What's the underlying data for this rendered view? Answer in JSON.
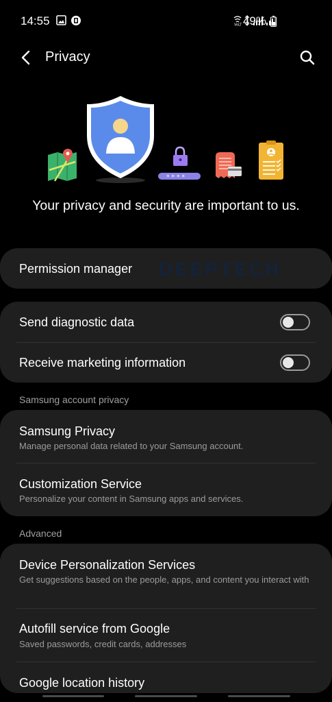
{
  "status_bar": {
    "time": "14:55",
    "battery": "49%",
    "icons": [
      "gallery-icon",
      "app-notification-icon",
      "wifi-calling-icon",
      "signal-icon",
      "signal-icon",
      "battery-icon"
    ]
  },
  "header": {
    "title": "Privacy",
    "back_icon": "back-arrow-icon",
    "search_icon": "search-icon"
  },
  "tagline": "Your privacy and security are important to us.",
  "watermark": "DEEPTECH",
  "permission_manager": {
    "title": "Permission manager"
  },
  "toggles": [
    {
      "title": "Send diagnostic data",
      "on": false
    },
    {
      "title": "Receive marketing information",
      "on": false
    }
  ],
  "samsung_section": {
    "header": "Samsung account privacy",
    "items": [
      {
        "title": "Samsung Privacy",
        "subtitle": "Manage personal data related to your Samsung account."
      },
      {
        "title": "Customization Service",
        "subtitle": "Personalize your content in Samsung apps and services."
      }
    ]
  },
  "advanced_section": {
    "header": "Advanced",
    "items": [
      {
        "title": "Device Personalization Services",
        "subtitle": "Get suggestions based on the people, apps, and content you interact with"
      },
      {
        "title": "Autofill service from Google",
        "subtitle": "Saved passwords, credit cards, addresses"
      },
      {
        "title": "Google location history",
        "subtitle": ""
      }
    ]
  },
  "colors": {
    "background": "#000000",
    "card": "#1f1f1f",
    "shield_blue": "#5b8bea",
    "subtitle": "#9c9c9c"
  }
}
